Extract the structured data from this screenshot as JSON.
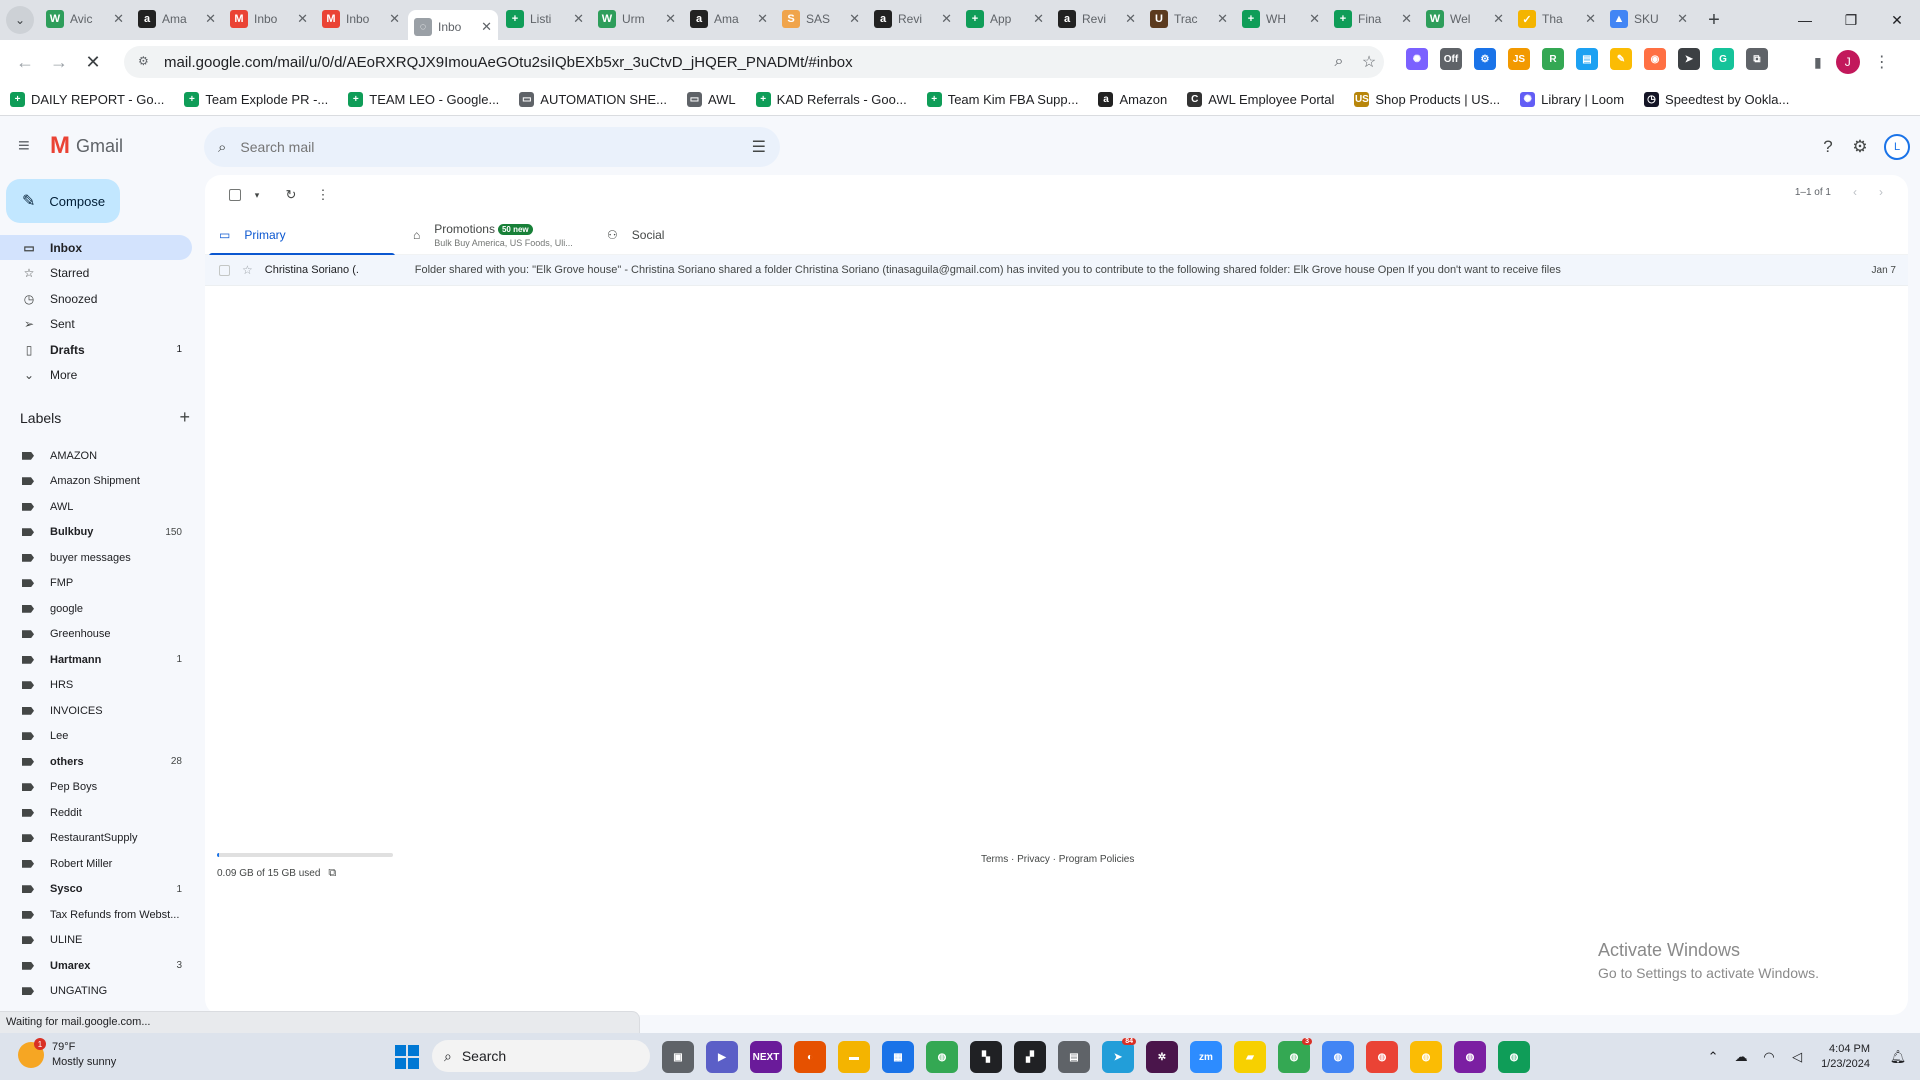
{
  "browser": {
    "tabs": [
      {
        "label": "Avic",
        "icon": "W",
        "color": "#2e9e5b",
        "active": false
      },
      {
        "label": "Ama",
        "icon": "a",
        "color": "#222222",
        "active": false
      },
      {
        "label": "Inbo",
        "icon": "M",
        "color": "#ea4335",
        "active": false
      },
      {
        "label": "Inbo",
        "icon": "M",
        "color": "#ea4335",
        "active": false
      },
      {
        "label": "Inbo",
        "icon": "◌",
        "color": "#9aa0a6",
        "active": true
      },
      {
        "label": "Listi",
        "icon": "+",
        "color": "#0f9d58",
        "active": false
      },
      {
        "label": "Urm",
        "icon": "W",
        "color": "#2e9e5b",
        "active": false
      },
      {
        "label": "Ama",
        "icon": "a",
        "color": "#222222",
        "active": false
      },
      {
        "label": "SAS",
        "icon": "S",
        "color": "#f0a44b",
        "active": false
      },
      {
        "label": "Revi",
        "icon": "a",
        "color": "#222222",
        "active": false
      },
      {
        "label": "App",
        "icon": "+",
        "color": "#0f9d58",
        "active": false
      },
      {
        "label": "Revi",
        "icon": "a",
        "color": "#222222",
        "active": false
      },
      {
        "label": "Trac",
        "icon": "U",
        "color": "#5b3a1e",
        "active": false
      },
      {
        "label": "WH",
        "icon": "+",
        "color": "#0f9d58",
        "active": false
      },
      {
        "label": "Fina",
        "icon": "+",
        "color": "#0f9d58",
        "active": false
      },
      {
        "label": "Wel",
        "icon": "W",
        "color": "#2e9e5b",
        "active": false
      },
      {
        "label": "Tha",
        "icon": "✓",
        "color": "#f4b400",
        "active": false
      },
      {
        "label": "SKU",
        "icon": "▲",
        "color": "#4285f4",
        "active": false
      }
    ],
    "url": "mail.google.com/mail/u/0/d/AEoRXRQJX9ImouAeGOtu2siIQbEXb5xr_3uCtvD_jHQER_PNADMt/#inbox",
    "profile_initial": "J",
    "extensions": [
      {
        "icon": "✺",
        "color": "#7b61ff"
      },
      {
        "icon": "Off",
        "color": "#5f6368"
      },
      {
        "icon": "⚙",
        "color": "#1a73e8"
      },
      {
        "icon": "JS",
        "color": "#f29900"
      },
      {
        "icon": "R",
        "color": "#34a853"
      },
      {
        "icon": "▤",
        "color": "#1da1f2"
      },
      {
        "icon": "✎",
        "color": "#fbbc04"
      },
      {
        "icon": "◉",
        "color": "#ff7043"
      },
      {
        "icon": "➤",
        "color": "#3c4043"
      },
      {
        "icon": "G",
        "color": "#15c39a"
      },
      {
        "icon": "⧉",
        "color": "#5f6368"
      }
    ],
    "bookmarks": [
      {
        "label": "DAILY REPORT - Go...",
        "icon": "+",
        "color": "#0f9d58"
      },
      {
        "label": "Team Explode PR -...",
        "icon": "+",
        "color": "#0f9d58"
      },
      {
        "label": "TEAM LEO - Google...",
        "icon": "+",
        "color": "#0f9d58"
      },
      {
        "label": "AUTOMATION SHE...",
        "icon": "▭",
        "color": "#5f6368"
      },
      {
        "label": "AWL",
        "icon": "▭",
        "color": "#5f6368"
      },
      {
        "label": "KAD Referrals - Goo...",
        "icon": "+",
        "color": "#0f9d58"
      },
      {
        "label": "Team Kim FBA Supp...",
        "icon": "+",
        "color": "#0f9d58"
      },
      {
        "label": "Amazon",
        "icon": "a",
        "color": "#222222"
      },
      {
        "label": "AWL Employee Portal",
        "icon": "C",
        "color": "#333333"
      },
      {
        "label": "Shop Products | US...",
        "icon": "US",
        "color": "#b8860b"
      },
      {
        "label": "Library | Loom",
        "icon": "✺",
        "color": "#625df5"
      },
      {
        "label": "Speedtest by Ookla...",
        "icon": "◷",
        "color": "#141526"
      }
    ],
    "status_text": "Waiting for mail.google.com..."
  },
  "gmail": {
    "logo_text": "Gmail",
    "search_placeholder": "Search mail",
    "account_initial": "L",
    "compose_label": "Compose",
    "nav": [
      {
        "label": "Inbox",
        "icon": "▭",
        "count": "",
        "active": true,
        "bold": true
      },
      {
        "label": "Starred",
        "icon": "☆",
        "count": "",
        "active": false,
        "bold": false
      },
      {
        "label": "Snoozed",
        "icon": "◷",
        "count": "",
        "active": false,
        "bold": false
      },
      {
        "label": "Sent",
        "icon": "➢",
        "count": "",
        "active": false,
        "bold": false
      },
      {
        "label": "Drafts",
        "icon": "▯",
        "count": "1",
        "active": false,
        "bold": true
      },
      {
        "label": "More",
        "icon": "⌄",
        "count": "",
        "active": false,
        "bold": false
      }
    ],
    "labels_title": "Labels",
    "labels": [
      {
        "label": "AMAZON",
        "count": "",
        "bold": false
      },
      {
        "label": "Amazon Shipment",
        "count": "",
        "bold": false
      },
      {
        "label": "AWL",
        "count": "",
        "bold": false
      },
      {
        "label": "Bulkbuy",
        "count": "150",
        "bold": true
      },
      {
        "label": "buyer messages",
        "count": "",
        "bold": false
      },
      {
        "label": "FMP",
        "count": "",
        "bold": false
      },
      {
        "label": "google",
        "count": "",
        "bold": false
      },
      {
        "label": "Greenhouse",
        "count": "",
        "bold": false
      },
      {
        "label": "Hartmann",
        "count": "1",
        "bold": true
      },
      {
        "label": "HRS",
        "count": "",
        "bold": false
      },
      {
        "label": "INVOICES",
        "count": "",
        "bold": false
      },
      {
        "label": "Lee",
        "count": "",
        "bold": false
      },
      {
        "label": "others",
        "count": "28",
        "bold": true
      },
      {
        "label": "Pep Boys",
        "count": "",
        "bold": false
      },
      {
        "label": "Reddit",
        "count": "",
        "bold": false
      },
      {
        "label": "RestaurantSupply",
        "count": "",
        "bold": false
      },
      {
        "label": "Robert Miller",
        "count": "",
        "bold": false
      },
      {
        "label": "Sysco",
        "count": "1",
        "bold": true
      },
      {
        "label": "Tax Refunds from Webst...",
        "count": "",
        "bold": false
      },
      {
        "label": "ULINE",
        "count": "",
        "bold": false
      },
      {
        "label": "Umarex",
        "count": "3",
        "bold": true
      },
      {
        "label": "UNGATING",
        "count": "",
        "bold": false
      }
    ],
    "pager_text": "1–1 of 1",
    "category_tabs": [
      {
        "label": "Primary",
        "icon": "▭",
        "sub": "",
        "badge": "",
        "active": true
      },
      {
        "label": "Promotions",
        "icon": "⌂",
        "sub": "Bulk Buy America, US Foods, Uli...",
        "badge": "50 new",
        "active": false
      },
      {
        "label": "Social",
        "icon": "⚇",
        "sub": "",
        "badge": "",
        "active": false
      }
    ],
    "emails": [
      {
        "sender": "Christina Soriano (.",
        "subject": "Folder shared with you: \"Elk Grove house\" - Christina Soriano shared a folder Christina Soriano (tinasaguila@gmail.com) has invited you to contribute to the following shared folder: Elk Grove house Open If you don't want to receive files",
        "date": "Jan 7"
      }
    ],
    "storage": {
      "text": "0.09 GB of 15 GB used",
      "fraction": 0.006
    },
    "footer_links": "Terms · Privacy · Program Policies"
  },
  "watermark": {
    "line1": "Activate Windows",
    "line2": "Go to Settings to activate Windows."
  },
  "taskbar": {
    "weather_temp": "79°F",
    "weather_desc": "Mostly sunny",
    "weather_badge": "1",
    "search_label": "Search",
    "apps": [
      {
        "icon": "▣",
        "color": "#5f6368",
        "badge": ""
      },
      {
        "icon": "▶",
        "color": "#5b5fc7",
        "badge": ""
      },
      {
        "icon": "NEXT",
        "color": "#6a1b9a",
        "badge": ""
      },
      {
        "icon": "◐",
        "color": "#e65100",
        "badge": ""
      },
      {
        "icon": "▬",
        "color": "#f4b400",
        "badge": ""
      },
      {
        "icon": "▦",
        "color": "#1a73e8",
        "badge": ""
      },
      {
        "icon": "◍",
        "color": "#34a853",
        "badge": ""
      },
      {
        "icon": "▚",
        "color": "#202124",
        "badge": ""
      },
      {
        "icon": "▞",
        "color": "#202124",
        "badge": ""
      },
      {
        "icon": "▤",
        "color": "#5f6368",
        "badge": ""
      },
      {
        "icon": "➤",
        "color": "#229ed9",
        "badge": "84"
      },
      {
        "icon": "✲",
        "color": "#4a154b",
        "badge": ""
      },
      {
        "icon": "zm",
        "color": "#2d8cff",
        "badge": ""
      },
      {
        "icon": "▰",
        "color": "#f7d000",
        "badge": ""
      },
      {
        "icon": "◍",
        "color": "#34a853",
        "badge": "3"
      },
      {
        "icon": "◍",
        "color": "#4285f4",
        "badge": ""
      },
      {
        "icon": "◍",
        "color": "#ea4335",
        "badge": ""
      },
      {
        "icon": "◍",
        "color": "#fbbc04",
        "badge": ""
      },
      {
        "icon": "◍",
        "color": "#7b1fa2",
        "badge": ""
      },
      {
        "icon": "◍",
        "color": "#0f9d58",
        "badge": ""
      }
    ],
    "time": "4:04 PM",
    "date": "1/23/2024"
  }
}
